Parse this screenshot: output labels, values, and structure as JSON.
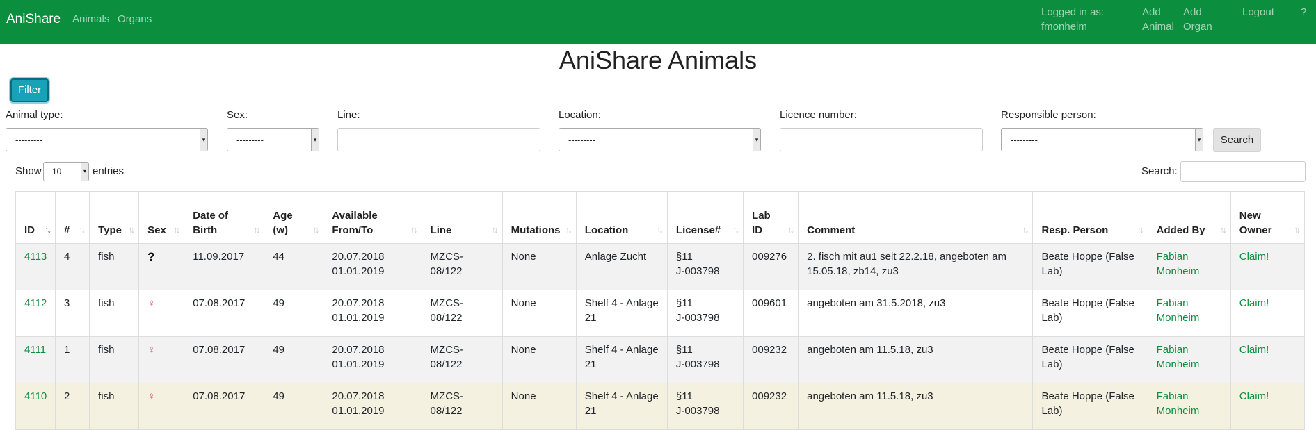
{
  "nav": {
    "brand": "AniShare",
    "links": [
      "Animals",
      "Organs"
    ],
    "logged_in_label": "Logged in as:",
    "username": "fmonheim",
    "add_animal_line1": "Add",
    "add_animal_line2": "Animal",
    "add_organ_line1": "Add",
    "add_organ_line2": "Organ",
    "logout": "Logout",
    "help": "?"
  },
  "page_title": "AniShare Animals",
  "filter_button": "Filter",
  "filters": {
    "animal_type_label": "Animal type:",
    "animal_type_value": "---------",
    "sex_label": "Sex:",
    "sex_value": "---------",
    "line_label": "Line:",
    "line_value": "",
    "location_label": "Location:",
    "location_value": "---------",
    "licence_label": "Licence number:",
    "licence_value": "",
    "responsible_label": "Responsible person:",
    "responsible_value": "---------",
    "search_button": "Search"
  },
  "table_controls": {
    "show_label": "Show",
    "entries_value": "10",
    "entries_label": "entries",
    "search_label": "Search:",
    "search_value": ""
  },
  "columns": {
    "id": "ID",
    "num": "#",
    "type": "Type",
    "sex": "Sex",
    "dob_1": "Date of",
    "dob_2": "Birth",
    "age_1": "Age",
    "age_2": "(w)",
    "avail_1": "Available",
    "avail_2": "From/To",
    "line": "Line",
    "mutations": "Mutations",
    "location": "Location",
    "license": "License#",
    "labid_1": "Lab",
    "labid_2": "ID",
    "comment": "Comment",
    "resp": "Resp. Person",
    "added_by": "Added By",
    "new_owner_1": "New",
    "new_owner_2": "Owner"
  },
  "sort_icons": {
    "active": "↑↓",
    "inactive": "↑↓"
  },
  "rows": [
    {
      "id": "4113",
      "num": "4",
      "type": "fish",
      "sex": "?",
      "dob": "11.09.2017",
      "age": "44",
      "avail_from": "20.07.2018",
      "avail_to": "01.01.2019",
      "line": "MZCS-08/122",
      "mutations": "None",
      "location_1": "Anlage Zucht",
      "location_2": "",
      "license_1": "§11",
      "license_2": "J-003798",
      "labid": "009276",
      "comment_1": "2. fisch mit au1 seit 22.2.18, angeboten am",
      "comment_2": "15.05.18, zb14, zu3",
      "resp_1": "Beate Hoppe (False",
      "resp_2": "Lab)",
      "added_1": "Fabian",
      "added_2": "Monheim",
      "owner": "Claim!"
    },
    {
      "id": "4112",
      "num": "3",
      "type": "fish",
      "sex": "♀",
      "dob": "07.08.2017",
      "age": "49",
      "avail_from": "20.07.2018",
      "avail_to": "01.01.2019",
      "line": "MZCS-08/122",
      "mutations": "None",
      "location_1": "Shelf 4 - Anlage",
      "location_2": "21",
      "license_1": "§11",
      "license_2": "J-003798",
      "labid": "009601",
      "comment_1": "angeboten am 31.5.2018, zu3",
      "comment_2": "",
      "resp_1": "Beate Hoppe (False",
      "resp_2": "Lab)",
      "added_1": "Fabian",
      "added_2": "Monheim",
      "owner": "Claim!"
    },
    {
      "id": "4111",
      "num": "1",
      "type": "fish",
      "sex": "♀",
      "dob": "07.08.2017",
      "age": "49",
      "avail_from": "20.07.2018",
      "avail_to": "01.01.2019",
      "line": "MZCS-08/122",
      "mutations": "None",
      "location_1": "Shelf 4 - Anlage",
      "location_2": "21",
      "license_1": "§11",
      "license_2": "J-003798",
      "labid": "009232",
      "comment_1": "angeboten am 11.5.18, zu3",
      "comment_2": "",
      "resp_1": "Beate Hoppe (False",
      "resp_2": "Lab)",
      "added_1": "Fabian",
      "added_2": "Monheim",
      "owner": "Claim!"
    },
    {
      "id": "4110",
      "num": "2",
      "type": "fish",
      "sex": "♀",
      "dob": "07.08.2017",
      "age": "49",
      "avail_from": "20.07.2018",
      "avail_to": "01.01.2019",
      "line": "MZCS-08/122",
      "mutations": "None",
      "location_1": "Shelf 4 - Anlage",
      "location_2": "21",
      "license_1": "§11",
      "license_2": "J-003798",
      "labid": "009232",
      "comment_1": "angeboten am 11.5.18, zu3",
      "comment_2": "",
      "resp_1": "Beate Hoppe (False",
      "resp_2": "Lab)",
      "added_1": "Fabian",
      "added_2": "Monheim",
      "owner": "Claim!"
    }
  ]
}
